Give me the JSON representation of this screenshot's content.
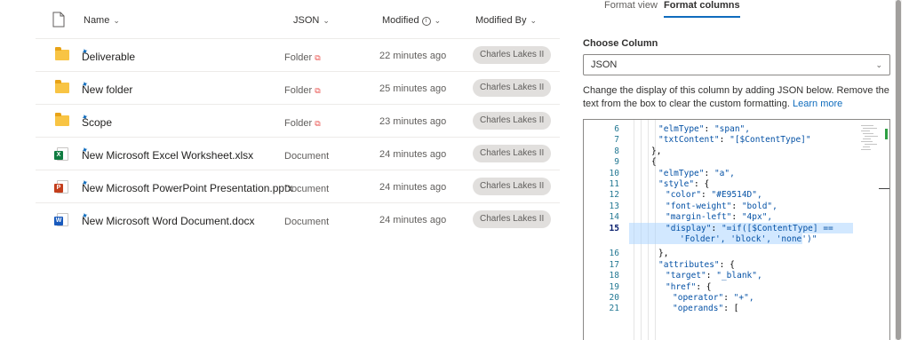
{
  "list": {
    "columns": {
      "name": "Name",
      "content_type": "JSON",
      "modified": "Modified",
      "modified_by": "Modified By"
    },
    "rows": [
      {
        "icon": "folder-icon",
        "name": "Deliverable",
        "content_type": "Folder",
        "modified": "22 minutes ago",
        "modified_by": "Charles Lakes II"
      },
      {
        "icon": "folder-icon",
        "name": "New folder",
        "content_type": "Folder",
        "modified": "25 minutes ago",
        "modified_by": "Charles Lakes II"
      },
      {
        "icon": "folder-icon",
        "name": "Scope",
        "content_type": "Folder",
        "modified": "23 minutes ago",
        "modified_by": "Charles Lakes II"
      },
      {
        "icon": "excel-icon",
        "name": "New Microsoft Excel Worksheet.xlsx",
        "content_type": "Document",
        "modified": "24 minutes ago",
        "modified_by": "Charles Lakes II"
      },
      {
        "icon": "powerpoint-icon",
        "name": "New Microsoft PowerPoint Presentation.pptx",
        "content_type": "Document",
        "modified": "24 minutes ago",
        "modified_by": "Charles Lakes II"
      },
      {
        "icon": "word-icon",
        "name": "New Microsoft Word Document.docx",
        "content_type": "Document",
        "modified": "24 minutes ago",
        "modified_by": "Charles Lakes II"
      }
    ],
    "link_color": "#E9514D"
  },
  "panel": {
    "tabs": [
      "Format view",
      "Format columns"
    ],
    "active_tab": "Format columns",
    "choose_column_label": "Choose Column",
    "selected_column": "JSON",
    "description": "Change the display of this column by adding JSON below. Remove the text from the box to clear the custom formatting.",
    "learn_more": "Learn more",
    "editor": {
      "current_line": "15",
      "lines": [
        {
          "n": "6",
          "text": "\"elmType\": \"span\","
        },
        {
          "n": "7",
          "text": "\"txtContent\": \"[$ContentType]\""
        },
        {
          "n": "8",
          "text": "},"
        },
        {
          "n": "9",
          "text": "{"
        },
        {
          "n": "10",
          "text": "\"elmType\": \"a\","
        },
        {
          "n": "11",
          "text": "\"style\": {"
        },
        {
          "n": "12",
          "text": "\"color\": \"#E9514D\","
        },
        {
          "n": "13",
          "text": "\"font-weight\": \"bold\","
        },
        {
          "n": "14",
          "text": "\"margin-left\": \"4px\","
        },
        {
          "n": "15",
          "text": "\"display\": \"=if([$ContentType] =="
        },
        {
          "n": "",
          "text": "'Folder', 'block', 'none')\""
        },
        {
          "n": "16",
          "text": "},"
        },
        {
          "n": "17",
          "text": "\"attributes\": {"
        },
        {
          "n": "18",
          "text": "\"target\": \"_blank\","
        },
        {
          "n": "19",
          "text": "\"href\": {"
        },
        {
          "n": "20",
          "text": "\"operator\": \"+\","
        },
        {
          "n": "21",
          "text": "\"operands\": ["
        }
      ]
    }
  },
  "colors": {
    "accent": "#0F6CBD",
    "pill_bg": "#E1DFDD",
    "folder": "#F8C444",
    "excel": "#107C41",
    "powerpoint": "#C43E1C",
    "word": "#185ABD"
  }
}
